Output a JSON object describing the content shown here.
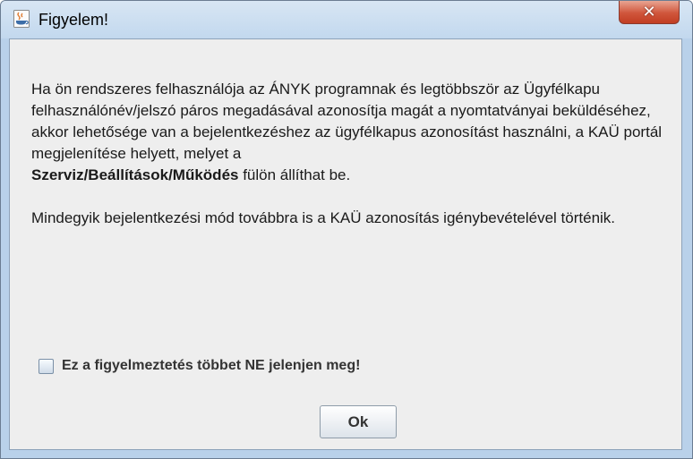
{
  "window": {
    "title": "Figyelem!",
    "close_glyph": "✕",
    "app_icon": "java-cup-icon"
  },
  "message": {
    "para1_before_bold": "Ha ön rendszeres felhasználója az ÁNYK programnak és legtöbbször az Ügyfélkapu felhasználónév/jelszó páros megadásával azonosítja magát a nyomtatványai beküldéséhez, akkor lehetősége van a bejelentkezéshez az ügyfélkapus azonosítást használni, a KAÜ portál megjelenítése helyett, melyet a",
    "para1_bold": "Szerviz/Beállítások/Működés",
    "para1_after_bold": " fülön állíthat be.",
    "para2": "Mindegyik bejelentkezési mód továbbra is a KAÜ azonosítás igénybevételével történik."
  },
  "checkbox": {
    "label": "Ez a figyelmeztetés többet NE jelenjen meg!",
    "checked": false
  },
  "ok_button": {
    "label": "Ok"
  },
  "colors": {
    "titlebar": "#c9dcef",
    "client_bg": "#eeeeee",
    "close_button": "#d0553b"
  }
}
